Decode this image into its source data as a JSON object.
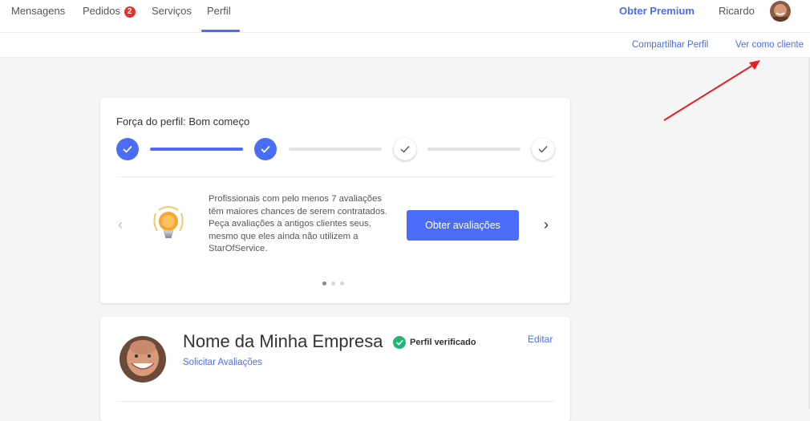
{
  "topnav": {
    "items": [
      {
        "label": "Mensagens"
      },
      {
        "label": "Pedidos",
        "badge": "2"
      },
      {
        "label": "Serviços"
      },
      {
        "label": "Perfil"
      }
    ],
    "premium_label": "Obter Premium",
    "user_name": "Ricardo"
  },
  "subnav": {
    "share_label": "Compartilhar Perfil",
    "view_as_client_label": "Ver como cliente"
  },
  "strength_card": {
    "title": "Força do perfil: Bom começo",
    "steps_completed": 2,
    "steps_total": 3,
    "tip_text": "Profissionais com pelo menos 7 avaliações têm maiores chances de serem contratados. Peça avaliações a antigos clientes seus, mesmo que eles ainda não utilizem a StarOfService.",
    "cta_label": "Obter avaliações",
    "carousel_active_index": 0,
    "carousel_total": 3
  },
  "profile_card": {
    "company_name": "Nome da Minha Empresa",
    "verified_label": "Perfil verificado",
    "request_reviews_label": "Solicitar Avaliações",
    "edit_label": "Editar"
  },
  "colors": {
    "accent": "#4a6cf7",
    "badge": "#e5322d",
    "verified": "#22b573",
    "annotation_arrow": "#e52020"
  }
}
